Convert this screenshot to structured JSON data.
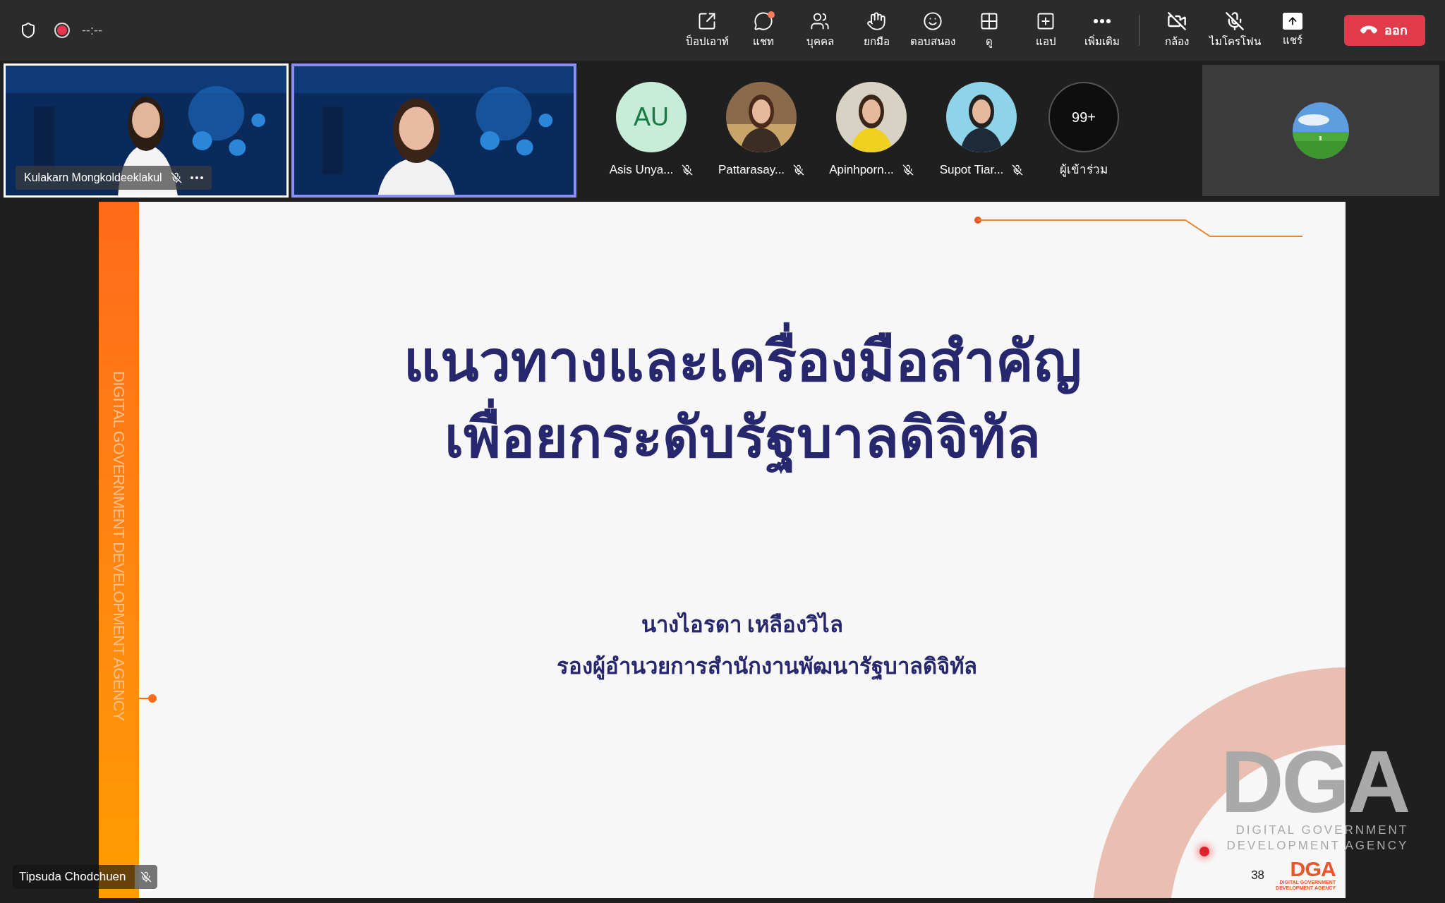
{
  "top_bar": {
    "timer": "--:--"
  },
  "toolbar": [
    {
      "label": "ป็อปเอาท์",
      "kind": "popout"
    },
    {
      "label": "แชท",
      "kind": "chat",
      "notification": true
    },
    {
      "label": "บุคคล",
      "kind": "people"
    },
    {
      "label": "ยกมือ",
      "kind": "hand"
    },
    {
      "label": "ตอบสนอง",
      "kind": "react"
    },
    {
      "label": "ดู",
      "kind": "view"
    },
    {
      "label": "แอป",
      "kind": "apps"
    },
    {
      "label": "เพิ่มเติม",
      "kind": "more"
    }
  ],
  "media_controls": [
    {
      "label": "กล้อง",
      "kind": "camera",
      "on": false
    },
    {
      "label": "ไมโครโฟน",
      "kind": "mic",
      "on": false
    },
    {
      "label": "แชร์",
      "kind": "share"
    }
  ],
  "leave_button": "ออก",
  "video_tiles": [
    {
      "name": "Kulakarn Mongkoldeeklakul",
      "muted": true,
      "active_speaker": false
    },
    {
      "active_speaker": true
    }
  ],
  "participants": [
    {
      "kind": "initials",
      "initials": "AU",
      "name": "Asis Unya...",
      "muted": true
    },
    {
      "kind": "picture",
      "name": "Pattarasay...",
      "muted": true
    },
    {
      "kind": "picture",
      "name": "Apinhporn...",
      "muted": true
    },
    {
      "kind": "picture",
      "name": "Supot Tiar...",
      "muted": true
    }
  ],
  "overflow": {
    "count": "99+",
    "label": "ผู้เข้าร่วม"
  },
  "slide": {
    "side_text": "DIGITAL GOVERNMENT DEVELOPMENT AGENCY",
    "title_lines": [
      "แนวทางและเครื่องมือสำคัญ",
      "เพื่อยกระดับรัฐบาลดิจิทัล"
    ],
    "presenter_name": "นางไอรดา เหลืองวิไล",
    "presenter_title": "รองผู้อำนวยการสำนักงานพัฒนารัฐบาลดิจิทัล",
    "logo": {
      "mark": "DGA",
      "lines": [
        "DIGITAL GOVERNMENT",
        "DEVELOPMENT AGENCY"
      ]
    },
    "page_number": "38",
    "small_logo": {
      "mark": "DGA",
      "lines": [
        "DIGITAL GOVERNMENT",
        "DEVELOPMENT AGENCY"
      ]
    }
  },
  "presenter_label": {
    "name": "Tipsuda Chodchuen",
    "muted": true
  }
}
